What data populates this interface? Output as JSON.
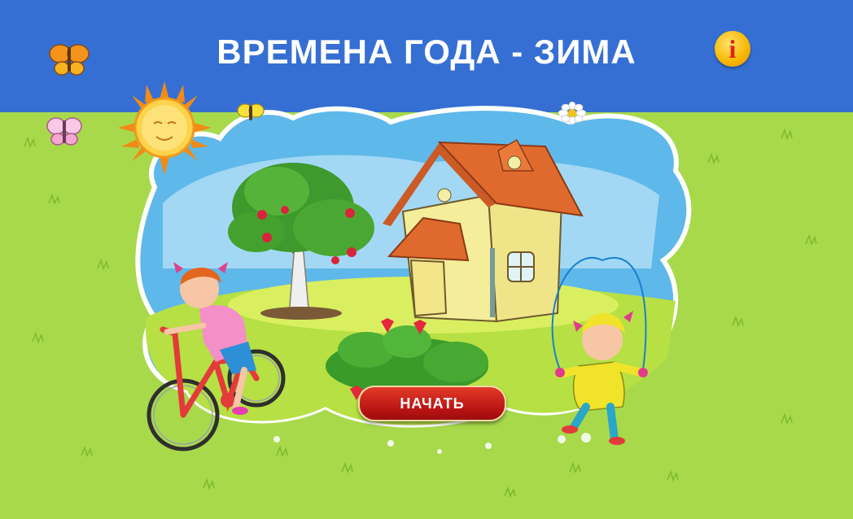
{
  "game": {
    "title": "ВРЕМЕНА ГОДА - ЗИМА",
    "info_label": "i",
    "start_label": "НАЧАТЬ"
  },
  "colors": {
    "sky_bar": "#356fd3",
    "grass": "#a7d94b",
    "start_button": "#c71a17",
    "info_button": "#f7b600"
  },
  "icons": [
    "butterfly-icon",
    "sun-icon",
    "flower-icon",
    "info-icon"
  ]
}
